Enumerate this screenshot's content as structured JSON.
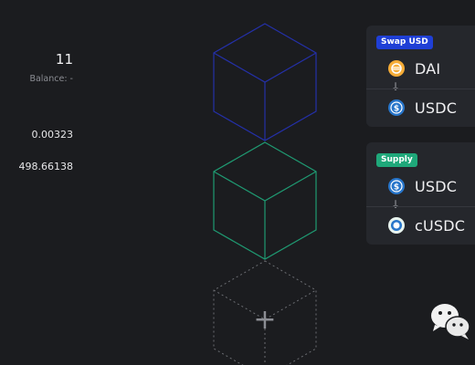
{
  "left": {
    "amount": "11",
    "balance": "Balance: -",
    "value_a": "0.00323",
    "value_b": "498.66138"
  },
  "cubes": [
    {
      "kind": "step",
      "color": "#2430a8"
    },
    {
      "kind": "step",
      "color": "#1f9a72"
    },
    {
      "kind": "add-step",
      "color": "#6b6d72",
      "plus": "+"
    }
  ],
  "cards": {
    "swap": {
      "badge": "Swap USD",
      "from_token": "DAI",
      "to_token": "USDC",
      "badge_color": "#1f3fd6"
    },
    "supply": {
      "badge": "Supply",
      "from_token": "USDC",
      "to_token": "cUSDC",
      "badge_color": "#1fa87a"
    }
  },
  "icons": {
    "dai": "dai-coin-icon",
    "usdc": "usdc-coin-icon",
    "cusdc": "cusdc-coin-icon",
    "arrow": "arrow-down-icon",
    "wechat": "wechat-icon"
  }
}
